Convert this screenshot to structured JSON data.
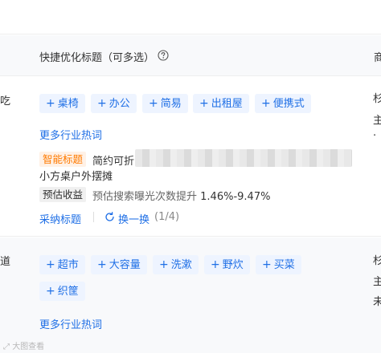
{
  "header": {
    "title": "快捷优化标题（可多选）",
    "right_fragment": "商"
  },
  "row1": {
    "left_fragment": "吃",
    "right_fragments": [
      "杉",
      "主",
      "·"
    ],
    "tags": [
      "桌椅",
      "办公",
      "简易",
      "出租屋",
      "便携式"
    ],
    "more_link": "更多行业热词",
    "smart_title_badge": "智能标题",
    "smart_title_text_start": "简约可折",
    "smart_title_text_line2": "小方桌户外摆摊",
    "estimate_badge": "预估收益",
    "estimate_text": "预估搜索曝光次数提升",
    "estimate_range": "1.46%-9.47%",
    "adopt_link": "采纳标题",
    "refresh_link": "换一换",
    "counter": "(1/4)"
  },
  "row2": {
    "left_fragment": "道",
    "right_fragments": [
      "杉",
      "主",
      "未"
    ],
    "tags": [
      "超市",
      "大容量",
      "洗漱",
      "野炊",
      "买菜",
      "织筐"
    ],
    "more_link": "更多行业热词"
  },
  "watermark": "大图查看",
  "colors": {
    "accent": "#1f6fe6",
    "tag_bg": "#eef4ff",
    "smart_badge_bg": "#fff1e6",
    "smart_badge_fg": "#ff7a00"
  },
  "icons": {
    "help": "question-circle-icon",
    "refresh": "refresh-icon",
    "tag_add": "plus-icon"
  }
}
